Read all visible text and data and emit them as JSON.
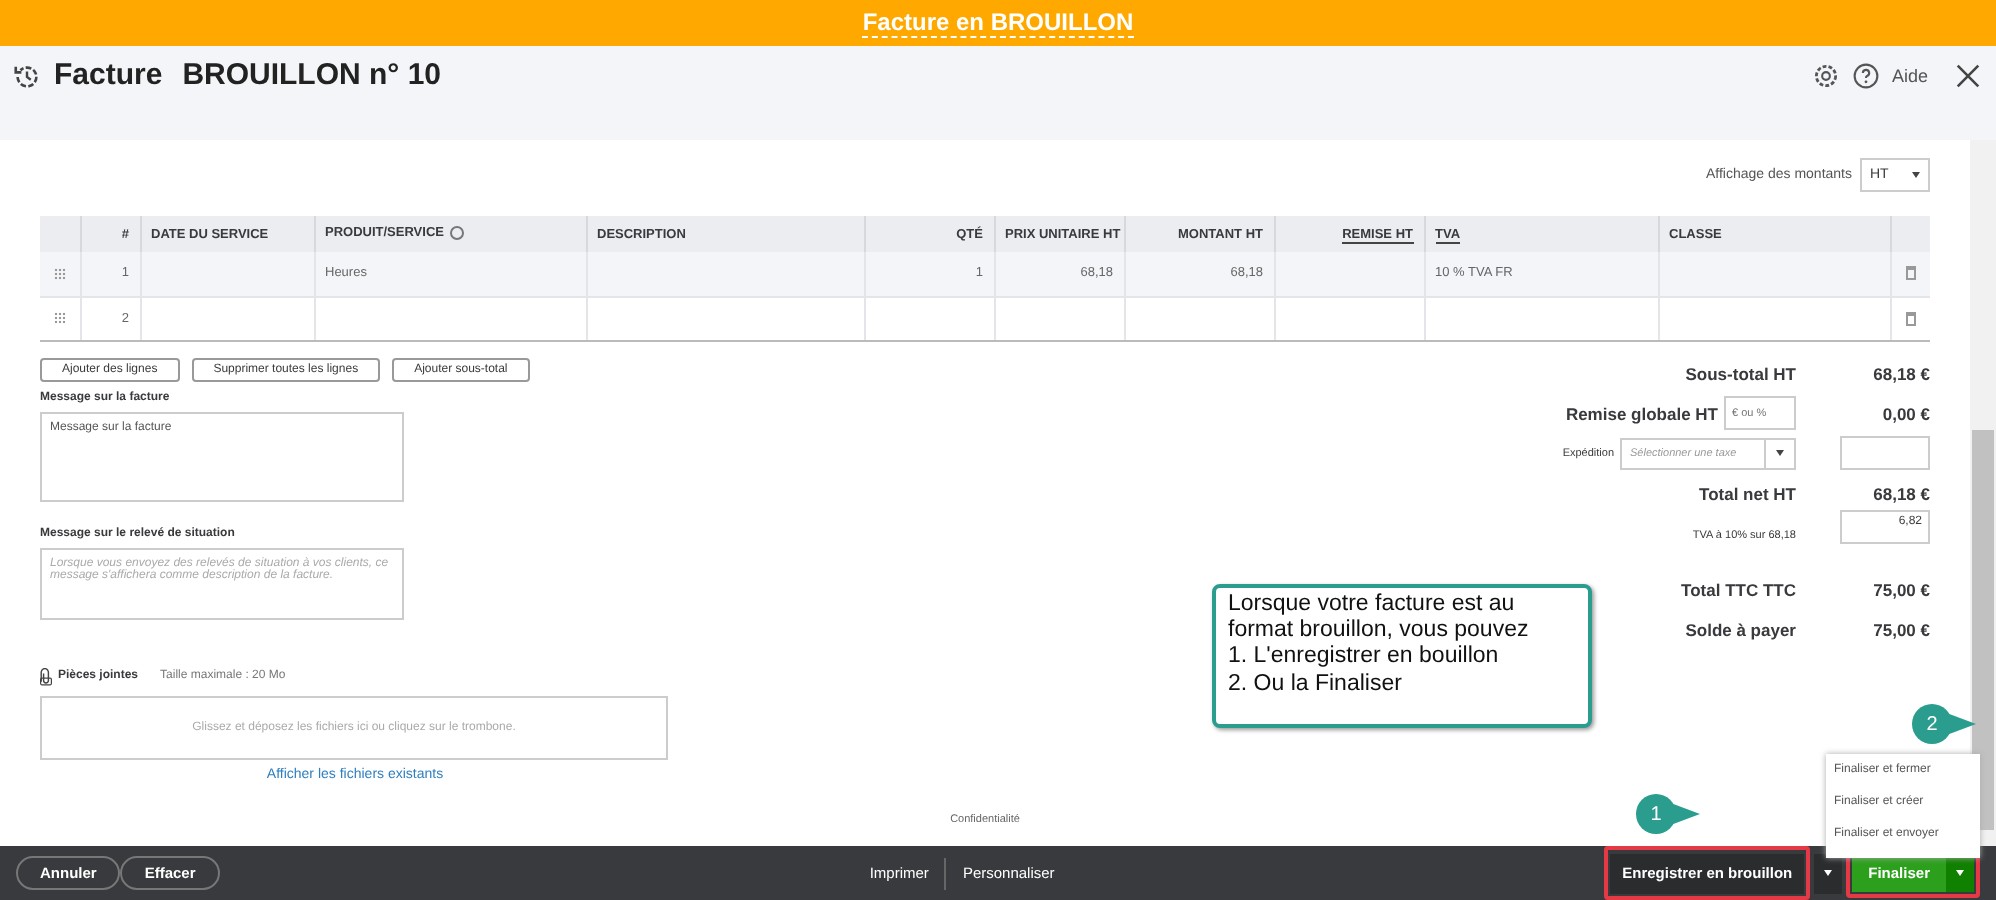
{
  "banner": {
    "text": "Facture en BROUILLON"
  },
  "header": {
    "title": "Facture",
    "subtitle": "BROUILLON n° 10",
    "help": "Aide"
  },
  "display_amounts": {
    "label": "Affichage des montants",
    "value": "HT"
  },
  "table": {
    "columns": [
      {},
      {
        "label": "#"
      },
      {
        "label": "DATE DU SERVICE"
      },
      {
        "label": "PRODUIT/SERVICE",
        "info": true
      },
      {
        "label": "DESCRIPTION"
      },
      {
        "label": "QTÉ"
      },
      {
        "label": "PRIX UNITAIRE HT"
      },
      {
        "label": "MONTANT HT"
      },
      {
        "label": "REMISE HT",
        "underlined": true
      },
      {
        "label": "TVA",
        "underlined": true
      },
      {
        "label": "CLASSE"
      },
      {}
    ],
    "rows": [
      {
        "cells": [
          "",
          "1",
          "",
          "Heures",
          "",
          "1",
          "68,18",
          "68,18",
          "",
          "10 % TVA FR",
          "",
          ""
        ]
      },
      {
        "cells": [
          "",
          "2",
          "",
          "",
          "",
          "",
          "",
          "",
          "",
          "",
          "",
          ""
        ]
      }
    ]
  },
  "line_buttons": [
    "Ajouter des lignes",
    "Supprimer toutes les lignes",
    "Ajouter sous-total"
  ],
  "invoice_message": {
    "label": "Message sur la facture",
    "value": "Message sur la facture"
  },
  "statement_message": {
    "label": "Message sur le relevé de situation",
    "placeholder": "Lorsque vous envoyez des relevés de situation à vos clients, ce message s'affichera comme description de la facture."
  },
  "attachments": {
    "label": "Pièces jointes",
    "max_size": "Taille maximale : 20 Mo",
    "dropzone": "Glissez et déposez les fichiers ici ou cliquez sur le trombone.",
    "link": "Afficher les fichiers existants"
  },
  "totals": [
    {
      "kind": "total",
      "label": "Sous-total HT",
      "value": "68,18 €"
    },
    {
      "kind": "discount",
      "label": "Remise globale HT",
      "placeholder": "€ ou %",
      "value": "0,00 €"
    },
    {
      "kind": "shipping",
      "label": "Expédition",
      "placeholder": "Sélectionner une taxe"
    },
    {
      "kind": "total",
      "label": "Total net HT",
      "value": "68,18 €"
    },
    {
      "kind": "tax",
      "label": "TVA à 10% sur 68,18",
      "value": "6,82"
    },
    {
      "kind": "total",
      "label": "Total TTC TTC",
      "value": "75,00 €"
    },
    {
      "kind": "total",
      "label": "Solde à payer",
      "value": "75,00 €"
    }
  ],
  "confidentiality": "Confidentialité",
  "callout": {
    "lines": [
      "Lorsque votre facture est au",
      "format brouillon, vous pouvez",
      "1. L'enregistrer en bouillon",
      "2. Ou la Finaliser"
    ]
  },
  "badges": [
    "1",
    "2"
  ],
  "footer": {
    "left_buttons": [
      "Annuler",
      "Effacer"
    ],
    "center_links": [
      "Imprimer",
      "Personnaliser"
    ],
    "save": "Enregistrer en brouillon",
    "finalize": "Finaliser"
  },
  "finalize_menu": [
    "Finaliser et fermer",
    "Finaliser et créer",
    "Finaliser et envoyer"
  ]
}
